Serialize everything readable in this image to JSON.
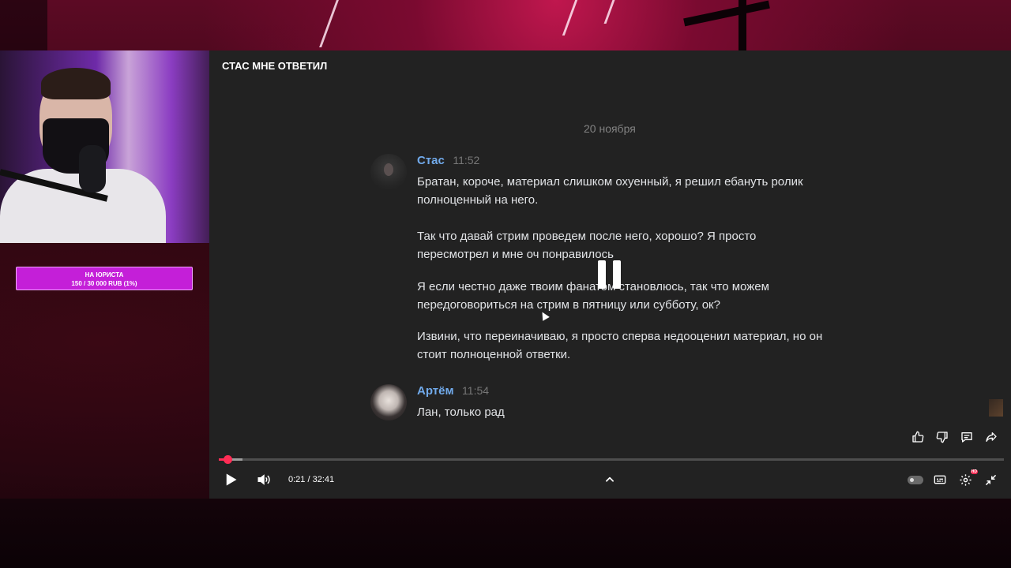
{
  "overlay": {
    "donation_title": "НА ЮРИСТА",
    "donation_progress": "150 / 30 000 RUB (1%)",
    "donation_fraction": 0.01
  },
  "player": {
    "title": "СТАС МНЕ ОТВЕТИЛ",
    "date_separator": "20 ноября",
    "messages": [
      {
        "author": "Стас",
        "time": "11:52",
        "paragraphs": [
          "Братан, короче, материал слишком охуенный, я решил ебануть ролик полноценный на него.",
          "Так что давай стрим проведем после него, хорошо? Я просто пересмотрел и мне оч понравилось",
          "Я если честно даже твоим фанатом становлюсь, так что можем передоговориться на стрим в пятницу или субботу, ок?",
          "Извини, что переиначиваю, я просто сперва недооценил материал, но он стоит полноценной ответки."
        ]
      },
      {
        "author": "Артём",
        "time": "11:54",
        "paragraphs": [
          "Лан, только рад"
        ]
      }
    ],
    "timecode": "0:21 / 32:41",
    "played_fraction": 0.011,
    "buffered_fraction": 0.03,
    "quality_badge": "HD",
    "accent_color": "#ff2d55",
    "author_color": "#71aaeb",
    "icons": {
      "actions": [
        "thumbs-up-icon",
        "thumbs-down-icon",
        "comment-icon",
        "share-icon"
      ],
      "left": [
        "play-icon",
        "volume-icon"
      ],
      "center": [
        "chevron-up-icon"
      ],
      "right": [
        "autoplay-toggle-icon",
        "subtitles-icon",
        "settings-icon",
        "exit-fullscreen-icon"
      ]
    }
  }
}
